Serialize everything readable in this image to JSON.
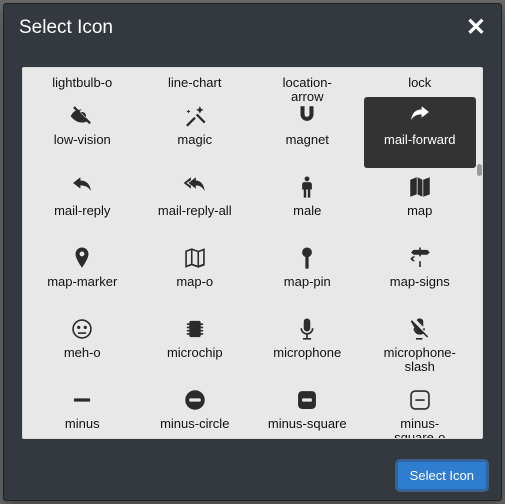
{
  "dialog": {
    "title": "Select Icon",
    "confirm_label": "Select Icon"
  },
  "icons": [
    {
      "id": "lightbulb-o",
      "label": "lightbulb-o",
      "selected": false,
      "partial": true
    },
    {
      "id": "line-chart",
      "label": "line-chart",
      "selected": false,
      "partial": true
    },
    {
      "id": "location-arrow",
      "label": "location-\narrow",
      "selected": false,
      "partial": true
    },
    {
      "id": "lock",
      "label": "lock",
      "selected": false,
      "partial": true
    },
    {
      "id": "low-vision",
      "label": "low-vision",
      "selected": false
    },
    {
      "id": "magic",
      "label": "magic",
      "selected": false
    },
    {
      "id": "magnet",
      "label": "magnet",
      "selected": false
    },
    {
      "id": "mail-forward",
      "label": "mail-forward",
      "selected": true
    },
    {
      "id": "mail-reply",
      "label": "mail-reply",
      "selected": false
    },
    {
      "id": "mail-reply-all",
      "label": "mail-reply-all",
      "selected": false
    },
    {
      "id": "male",
      "label": "male",
      "selected": false
    },
    {
      "id": "map",
      "label": "map",
      "selected": false
    },
    {
      "id": "map-marker",
      "label": "map-marker",
      "selected": false
    },
    {
      "id": "map-o",
      "label": "map-o",
      "selected": false
    },
    {
      "id": "map-pin",
      "label": "map-pin",
      "selected": false
    },
    {
      "id": "map-signs",
      "label": "map-signs",
      "selected": false
    },
    {
      "id": "meh-o",
      "label": "meh-o",
      "selected": false
    },
    {
      "id": "microchip",
      "label": "microchip",
      "selected": false
    },
    {
      "id": "microphone",
      "label": "microphone",
      "selected": false
    },
    {
      "id": "microphone-slash",
      "label": "microphone-\nslash",
      "selected": false
    },
    {
      "id": "minus",
      "label": "minus",
      "selected": false
    },
    {
      "id": "minus-circle",
      "label": "minus-circle",
      "selected": false
    },
    {
      "id": "minus-square",
      "label": "minus-square",
      "selected": false
    },
    {
      "id": "minus-square-o",
      "label": "minus-\nsquare-o",
      "selected": false
    }
  ]
}
